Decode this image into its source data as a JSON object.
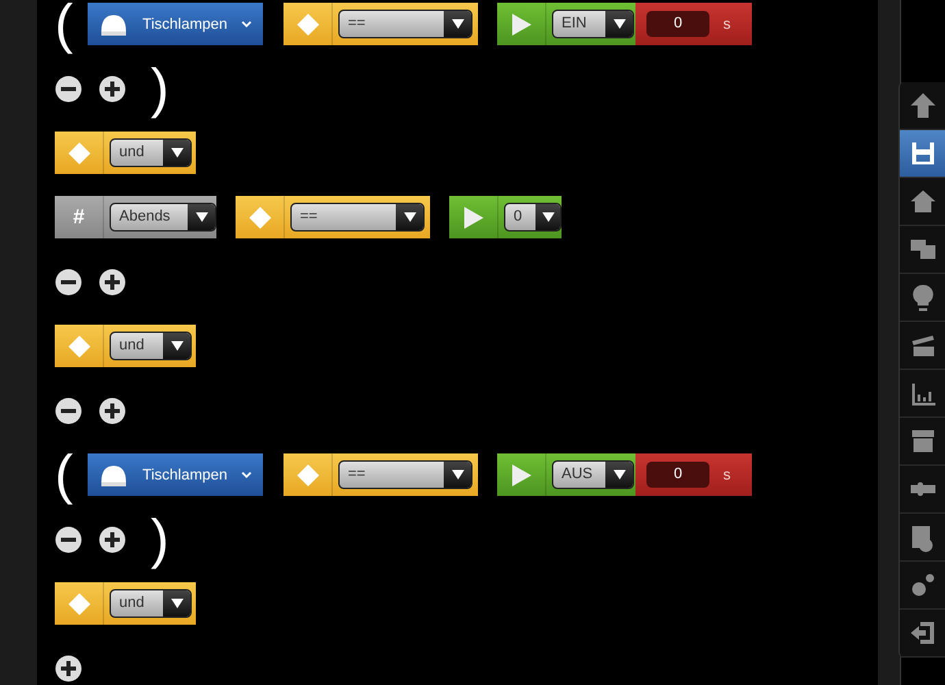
{
  "rows": [
    {
      "kind": "condition",
      "paren": "(",
      "device": "Tischlampen",
      "operator": "==",
      "value": "EIN",
      "delay": "0",
      "unit": "s"
    },
    {
      "kind": "controls",
      "remove": true,
      "paren": ")"
    },
    {
      "kind": "logic",
      "operator": "und"
    },
    {
      "kind": "variable",
      "symbol": "#",
      "variable": "Abends",
      "operator": "==",
      "value": "0"
    },
    {
      "kind": "controls",
      "remove": true
    },
    {
      "kind": "logic",
      "operator": "und"
    },
    {
      "kind": "controls",
      "remove": true
    },
    {
      "kind": "condition",
      "paren": "(",
      "device": "Tischlampen",
      "operator": "==",
      "value": "AUS",
      "delay": "0",
      "unit": "s"
    },
    {
      "kind": "controls",
      "remove": true,
      "paren": ")"
    },
    {
      "kind": "logic",
      "operator": "und"
    },
    {
      "kind": "controls",
      "remove": false
    }
  ],
  "sidebar": {
    "items": [
      {
        "selected": false
      },
      {
        "selected": true
      },
      {
        "selected": false
      },
      {
        "selected": false
      },
      {
        "selected": false
      },
      {
        "selected": false
      },
      {
        "selected": false
      },
      {
        "selected": false
      },
      {
        "selected": false
      },
      {
        "selected": false
      },
      {
        "selected": false
      },
      {
        "selected": false
      }
    ]
  }
}
